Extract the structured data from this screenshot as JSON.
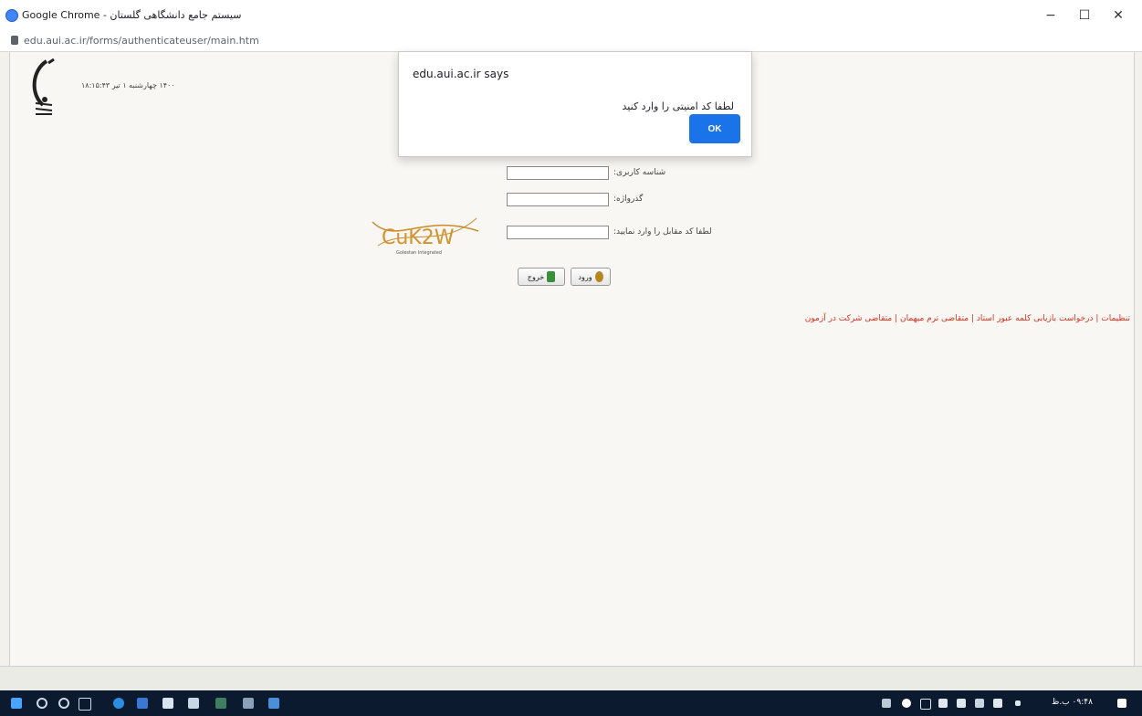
{
  "window": {
    "title": "Google Chrome - سیستم جامع دانشگاهی گلستان",
    "url": "edu.aui.ac.ir/forms/authenticateuser/main.htm",
    "controls": {
      "minimize": "−",
      "restore": "☐",
      "close": "✕"
    }
  },
  "page": {
    "datetime": "۱۴۰۰ چهارشنبه ۱ تیر ۱۸:۱۵:۴۳",
    "form": {
      "username_label": "شناسه کاربری:",
      "username_value": "",
      "password_label": "گذرواژه:",
      "password_value": "",
      "captcha_label": "لطفا کد مقابل را وارد نمایید:",
      "captcha_value": "",
      "captcha_text": "CuK2W",
      "captcha_subtext": "Golestan Integrated"
    },
    "buttons": {
      "exit_label": "خروج",
      "login_label": "ورود"
    },
    "links": [
      "تنظیمات",
      "درخواست بازیابی کلمه عبور استاد",
      "متقاضی ترم میهمان",
      "متقاضی شرکت در آزمون"
    ],
    "links_separator": "|"
  },
  "dialog": {
    "title": "edu.aui.ac.ir says",
    "message": "لطفا کد امنیتی را وارد کنید",
    "ok_label": "OK"
  },
  "taskbar": {
    "clock": "۰۹:۴۸ ب.ظ"
  }
}
